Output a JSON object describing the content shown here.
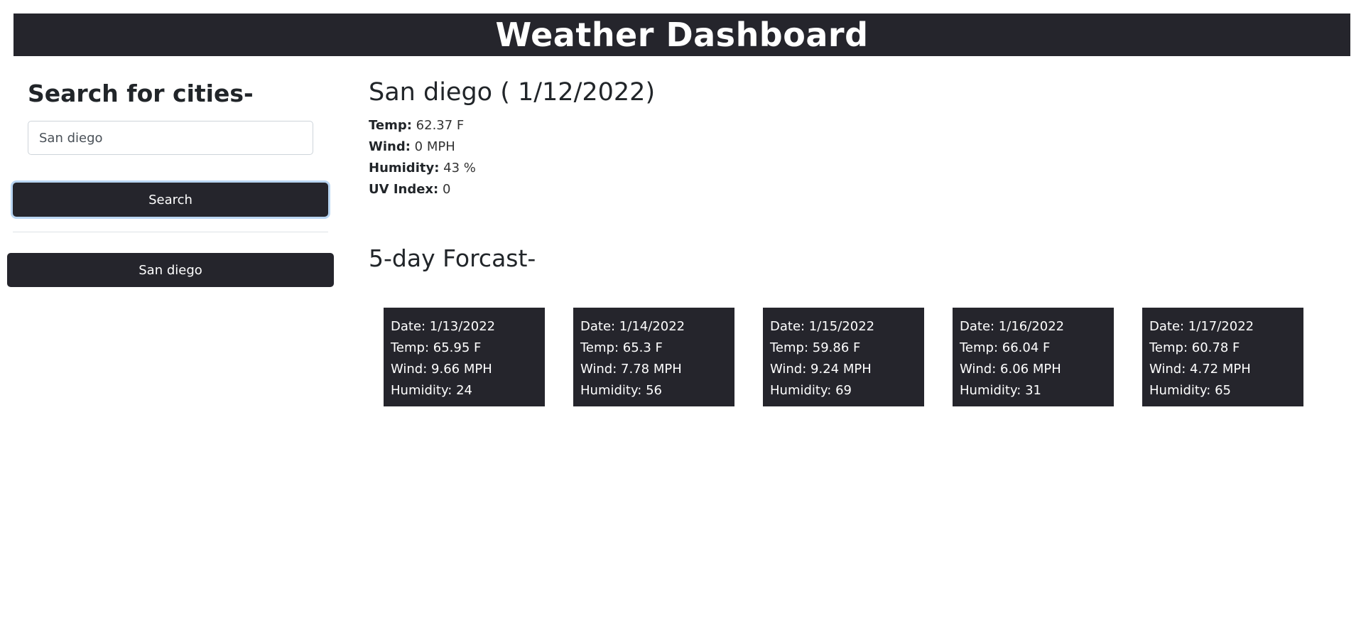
{
  "header": {
    "title": "Weather Dashboard"
  },
  "sidebar": {
    "title": "Search for cities-",
    "search_value": "San diego",
    "search_button_label": "Search",
    "history": [
      {
        "label": "San diego"
      }
    ]
  },
  "current": {
    "title": "San diego ( 1/12/2022)",
    "stats": [
      {
        "label": "Temp:",
        "value": "62.37 F"
      },
      {
        "label": "Wind:",
        "value": "0 MPH"
      },
      {
        "label": "Humidity:",
        "value": "43 %"
      },
      {
        "label": "UV Index:",
        "value": "0"
      }
    ]
  },
  "forecast": {
    "title": "5-day Forcast-",
    "days": [
      {
        "date": "Date: 1/13/2022",
        "temp": "Temp: 65.95 F",
        "wind": "Wind: 9.66 MPH",
        "humidity": "Humidity: 24"
      },
      {
        "date": "Date: 1/14/2022",
        "temp": "Temp: 65.3 F",
        "wind": "Wind: 7.78 MPH",
        "humidity": "Humidity: 56"
      },
      {
        "date": "Date: 1/15/2022",
        "temp": "Temp: 59.86 F",
        "wind": "Wind: 9.24 MPH",
        "humidity": "Humidity: 69"
      },
      {
        "date": "Date: 1/16/2022",
        "temp": "Temp: 66.04 F",
        "wind": "Wind: 6.06 MPH",
        "humidity": "Humidity: 31"
      },
      {
        "date": "Date: 1/17/2022",
        "temp": "Temp: 60.78 F",
        "wind": "Wind: 4.72 MPH",
        "humidity": "Humidity: 65"
      }
    ]
  },
  "colors": {
    "dark": "#25252c",
    "focus_ring": "#b9d6f3"
  }
}
